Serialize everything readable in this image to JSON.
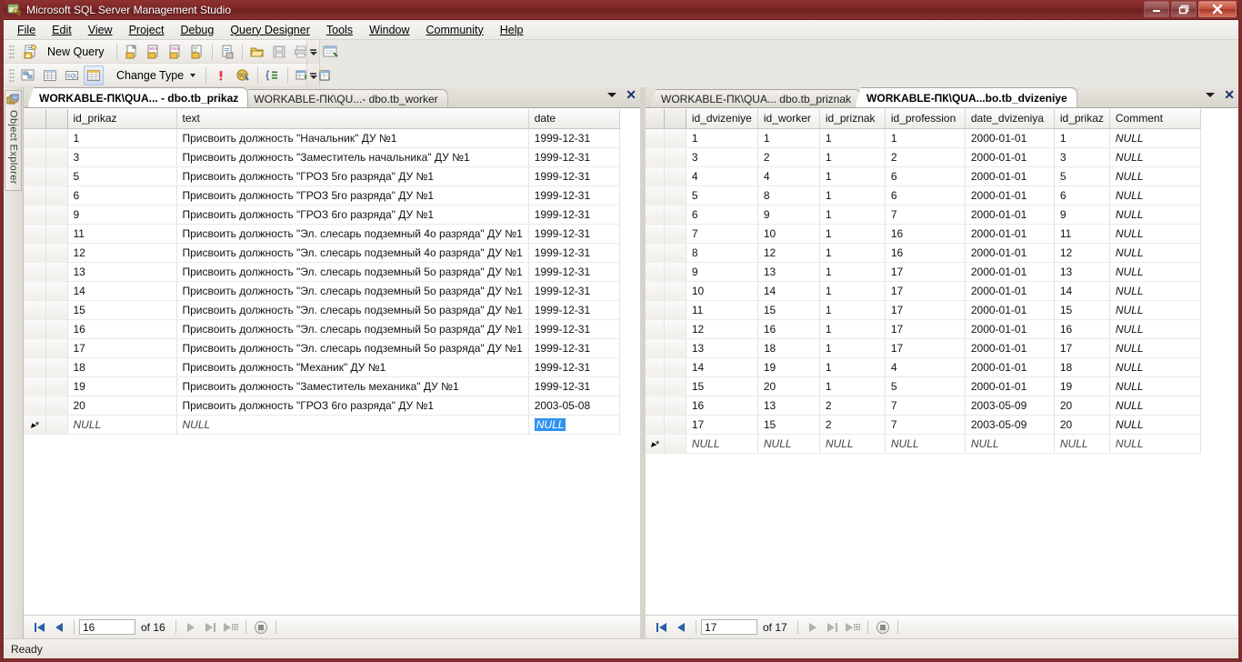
{
  "window": {
    "title": "Microsoft SQL Server Management Studio",
    "icon": "ssms-app-icon",
    "controls": {
      "minimize": "–",
      "restore": "❐",
      "close": "✕"
    }
  },
  "menubar": {
    "items": [
      {
        "label": "File",
        "accel": "F"
      },
      {
        "label": "Edit",
        "accel": "E"
      },
      {
        "label": "View",
        "accel": "V"
      },
      {
        "label": "Project",
        "accel": "P"
      },
      {
        "label": "Debug",
        "accel": "D"
      },
      {
        "label": "Query Designer",
        "accel": "Q"
      },
      {
        "label": "Tools",
        "accel": "T"
      },
      {
        "label": "Window",
        "accel": "W"
      },
      {
        "label": "Community",
        "accel": "C"
      },
      {
        "label": "Help",
        "accel": "H"
      }
    ]
  },
  "toolbar_standard": {
    "new_query_label": "New Query",
    "buttons": [
      "new-query-icon",
      "new-database-query-icon",
      "new-mdx-query-icon",
      "new-dmx-query-icon",
      "new-xmla-query-icon",
      "new-analysis-query-icon",
      "open-file-icon",
      "save-icon",
      "print-icon",
      "show-diagram-pane-icon"
    ]
  },
  "toolbar_designer": {
    "change_type_label": "Change Type",
    "buttons": [
      "show-diagram-pane-icon",
      "show-criteria-pane-icon",
      "show-sql-pane-icon",
      "show-results-pane-icon",
      "change-type-icon",
      "execute-sql-icon",
      "verify-sql-icon",
      "group-by-icon",
      "add-table-icon",
      "add-new-derived-table-icon"
    ]
  },
  "object_explorer": {
    "label": "Object Explorer",
    "icon": "object-explorer-icon"
  },
  "left_pane": {
    "tabs": [
      {
        "label": "WORKABLE-ПК\\QUA... - dbo.tb_prikaz",
        "selected": true
      },
      {
        "label": "WORKABLE-ПК\\QU...- dbo.tb_worker",
        "selected": false
      }
    ],
    "tab_actions": {
      "dropdown": "tab-list-dropdown",
      "close": "✕"
    },
    "columns": [
      "id_prikaz",
      "text",
      "date"
    ],
    "rows": [
      {
        "id_prikaz": "1",
        "text": "Присвоить должность \"Начальник\" ДУ №1",
        "date": "1999-12-31"
      },
      {
        "id_prikaz": "3",
        "text": "Присвоить должность \"Заместитель начальника\" ДУ №1",
        "date": "1999-12-31"
      },
      {
        "id_prikaz": "5",
        "text": "Присвоить должность \"ГРОЗ 5го разряда\" ДУ №1",
        "date": "1999-12-31"
      },
      {
        "id_prikaz": "6",
        "text": "Присвоить должность \"ГРОЗ 5го разряда\" ДУ №1",
        "date": "1999-12-31"
      },
      {
        "id_prikaz": "9",
        "text": "Присвоить должность \"ГРОЗ 6го разряда\" ДУ №1",
        "date": "1999-12-31"
      },
      {
        "id_prikaz": "11",
        "text": "Присвоить должность \"Эл. слесарь подземный 4о разряда\" ДУ №1",
        "date": "1999-12-31"
      },
      {
        "id_prikaz": "12",
        "text": "Присвоить должность \"Эл. слесарь подземный 4о разряда\" ДУ №1",
        "date": "1999-12-31"
      },
      {
        "id_prikaz": "13",
        "text": "Присвоить должность \"Эл. слесарь подземный 5о разряда\" ДУ №1",
        "date": "1999-12-31"
      },
      {
        "id_prikaz": "14",
        "text": "Присвоить должность \"Эл. слесарь подземный 5о разряда\" ДУ №1",
        "date": "1999-12-31"
      },
      {
        "id_prikaz": "15",
        "text": "Присвоить должность \"Эл. слесарь подземный 5о разряда\" ДУ №1",
        "date": "1999-12-31"
      },
      {
        "id_prikaz": "16",
        "text": "Присвоить должность \"Эл. слесарь подземный 5о разряда\" ДУ №1",
        "date": "1999-12-31"
      },
      {
        "id_prikaz": "17",
        "text": "Присвоить должность \"Эл. слесарь подземный 5о разряда\" ДУ №1",
        "date": "1999-12-31"
      },
      {
        "id_prikaz": "18",
        "text": "Присвоить должность \"Механик\" ДУ №1",
        "date": "1999-12-31"
      },
      {
        "id_prikaz": "19",
        "text": "Присвоить должность \"Заместитель механика\" ДУ №1",
        "date": "1999-12-31"
      },
      {
        "id_prikaz": "20",
        "text": "Присвоить должность \"ГРОЗ 6го разряда\" ДУ №1",
        "date": "2003-05-08"
      }
    ],
    "new_row": {
      "marker": "▸*",
      "id_prikaz": "NULL",
      "text": "NULL",
      "date": "NULL",
      "date_selected": true
    },
    "nav": {
      "current": "16",
      "of": "of 16"
    }
  },
  "right_pane": {
    "tabs": [
      {
        "label": "WORKABLE-ПК\\QUA... dbo.tb_priznak",
        "selected": false
      },
      {
        "label": "WORKABLE-ПК\\QUA...bo.tb_dvizeniye",
        "selected": true
      }
    ],
    "tab_actions": {
      "dropdown": "tab-list-dropdown",
      "close": "✕"
    },
    "columns": [
      "id_dvizeniye",
      "id_worker",
      "id_priznak",
      "id_profession",
      "date_dvizeniya",
      "id_prikaz",
      "Comment"
    ],
    "rows": [
      {
        "id_dvizeniye": "1",
        "id_worker": "1",
        "id_priznak": "1",
        "id_profession": "1",
        "date_dvizeniya": "2000-01-01",
        "id_prikaz": "1",
        "Comment": "NULL"
      },
      {
        "id_dvizeniye": "3",
        "id_worker": "2",
        "id_priznak": "1",
        "id_profession": "2",
        "date_dvizeniya": "2000-01-01",
        "id_prikaz": "3",
        "Comment": "NULL"
      },
      {
        "id_dvizeniye": "4",
        "id_worker": "4",
        "id_priznak": "1",
        "id_profession": "6",
        "date_dvizeniya": "2000-01-01",
        "id_prikaz": "5",
        "Comment": "NULL"
      },
      {
        "id_dvizeniye": "5",
        "id_worker": "8",
        "id_priznak": "1",
        "id_profession": "6",
        "date_dvizeniya": "2000-01-01",
        "id_prikaz": "6",
        "Comment": "NULL"
      },
      {
        "id_dvizeniye": "6",
        "id_worker": "9",
        "id_priznak": "1",
        "id_profession": "7",
        "date_dvizeniya": "2000-01-01",
        "id_prikaz": "9",
        "Comment": "NULL"
      },
      {
        "id_dvizeniye": "7",
        "id_worker": "10",
        "id_priznak": "1",
        "id_profession": "16",
        "date_dvizeniya": "2000-01-01",
        "id_prikaz": "11",
        "Comment": "NULL"
      },
      {
        "id_dvizeniye": "8",
        "id_worker": "12",
        "id_priznak": "1",
        "id_profession": "16",
        "date_dvizeniya": "2000-01-01",
        "id_prikaz": "12",
        "Comment": "NULL"
      },
      {
        "id_dvizeniye": "9",
        "id_worker": "13",
        "id_priznak": "1",
        "id_profession": "17",
        "date_dvizeniya": "2000-01-01",
        "id_prikaz": "13",
        "Comment": "NULL"
      },
      {
        "id_dvizeniye": "10",
        "id_worker": "14",
        "id_priznak": "1",
        "id_profession": "17",
        "date_dvizeniya": "2000-01-01",
        "id_prikaz": "14",
        "Comment": "NULL"
      },
      {
        "id_dvizeniye": "11",
        "id_worker": "15",
        "id_priznak": "1",
        "id_profession": "17",
        "date_dvizeniya": "2000-01-01",
        "id_prikaz": "15",
        "Comment": "NULL"
      },
      {
        "id_dvizeniye": "12",
        "id_worker": "16",
        "id_priznak": "1",
        "id_profession": "17",
        "date_dvizeniya": "2000-01-01",
        "id_prikaz": "16",
        "Comment": "NULL"
      },
      {
        "id_dvizeniye": "13",
        "id_worker": "18",
        "id_priznak": "1",
        "id_profession": "17",
        "date_dvizeniya": "2000-01-01",
        "id_prikaz": "17",
        "Comment": "NULL"
      },
      {
        "id_dvizeniye": "14",
        "id_worker": "19",
        "id_priznak": "1",
        "id_profession": "4",
        "date_dvizeniya": "2000-01-01",
        "id_prikaz": "18",
        "Comment": "NULL"
      },
      {
        "id_dvizeniye": "15",
        "id_worker": "20",
        "id_priznak": "1",
        "id_profession": "5",
        "date_dvizeniya": "2000-01-01",
        "id_prikaz": "19",
        "Comment": "NULL"
      },
      {
        "id_dvizeniye": "16",
        "id_worker": "13",
        "id_priznak": "2",
        "id_profession": "7",
        "date_dvizeniya": "2003-05-09",
        "id_prikaz": "20",
        "Comment": "NULL"
      },
      {
        "id_dvizeniye": "17",
        "id_worker": "15",
        "id_priznak": "2",
        "id_profession": "7",
        "date_dvizeniya": "2003-05-09",
        "id_prikaz": "20",
        "Comment": "NULL"
      }
    ],
    "new_row": {
      "marker": "▸*",
      "id_dvizeniye": "NULL",
      "id_worker": "NULL",
      "id_priznak": "NULL",
      "id_profession": "NULL",
      "date_dvizeniya": "NULL",
      "id_prikaz": "NULL",
      "Comment": "NULL"
    },
    "nav": {
      "current": "17",
      "of": "of 17"
    }
  },
  "statusbar": {
    "text": "Ready"
  },
  "colors": {
    "title_bar": "#7c2626",
    "selection": "#2f94f0",
    "id_column_text": "#6b5b3e",
    "nav_arrow": "#2a5fa8"
  }
}
